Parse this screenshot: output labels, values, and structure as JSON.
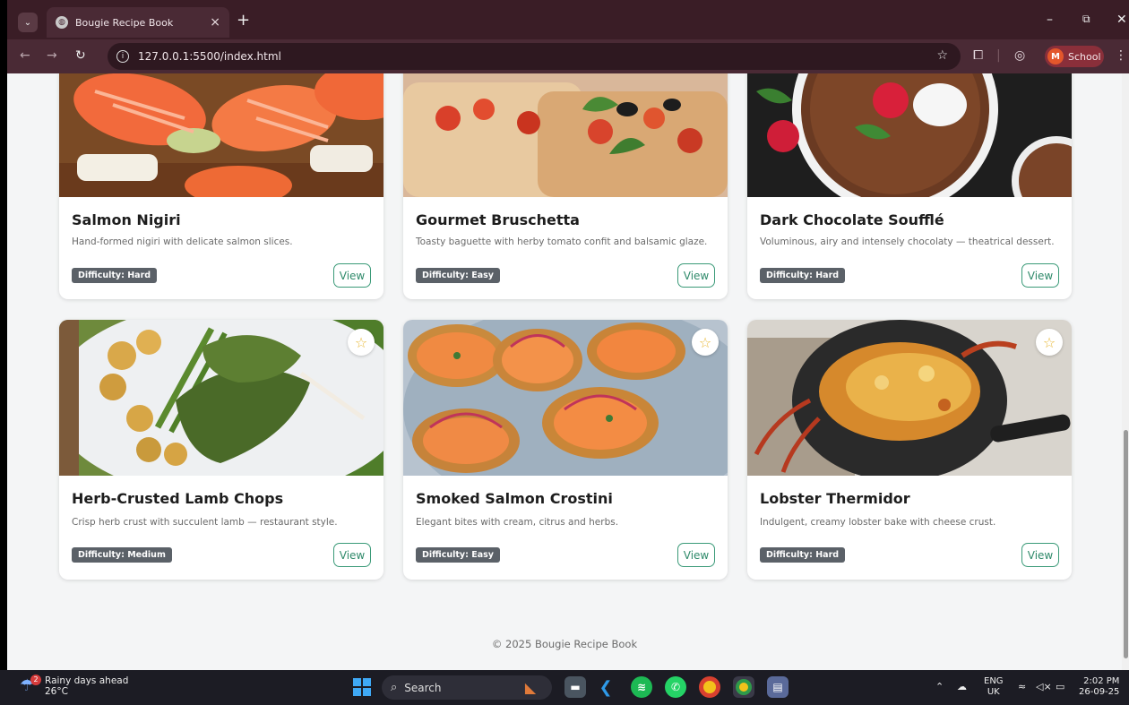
{
  "browser": {
    "tab_title": "Bougie Recipe Book",
    "url": "127.0.0.1:5500/index.html",
    "profile_label": "School",
    "profile_initial": "M"
  },
  "recipes": [
    {
      "title": "Salmon Nigiri",
      "description": "Hand-formed nigiri with delicate salmon slices.",
      "difficulty": "Difficulty: Hard",
      "view_label": "View"
    },
    {
      "title": "Gourmet Bruschetta",
      "description": "Toasty baguette with herby tomato confit and balsamic glaze.",
      "difficulty": "Difficulty: Easy",
      "view_label": "View"
    },
    {
      "title": "Dark Chocolate Soufflé",
      "description": "Voluminous, airy and intensely chocolaty — theatrical dessert.",
      "difficulty": "Difficulty: Hard",
      "view_label": "View"
    },
    {
      "title": "Herb-Crusted Lamb Chops",
      "description": "Crisp herb crust with succulent lamb — restaurant style.",
      "difficulty": "Difficulty: Medium",
      "view_label": "View"
    },
    {
      "title": "Smoked Salmon Crostini",
      "description": "Elegant bites with cream, citrus and herbs.",
      "difficulty": "Difficulty: Easy",
      "view_label": "View"
    },
    {
      "title": "Lobster Thermidor",
      "description": "Indulgent, creamy lobster bake with cheese crust.",
      "difficulty": "Difficulty: Hard",
      "view_label": "View"
    }
  ],
  "footer": {
    "text": "© 2025 Bougie Recipe Book"
  },
  "taskbar": {
    "weather_title": "Rainy days ahead",
    "weather_temp": "26°C",
    "weather_badge": "2",
    "search_label": "Search",
    "lang_top": "ENG",
    "lang_bottom": "UK",
    "time": "2:02 PM",
    "date": "26-09-25"
  },
  "colors": {
    "accent": "#3a9a78",
    "badge": "#5b6168",
    "browser_frame": "#4a2a35",
    "favorite_star": "#e8b938"
  }
}
